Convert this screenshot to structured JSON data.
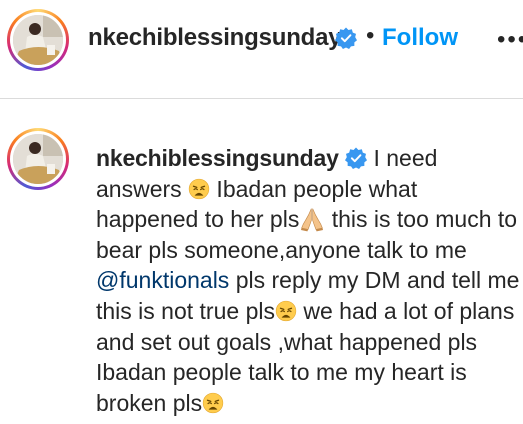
{
  "header": {
    "username": "nkechiblessingsunday",
    "separator": "•",
    "follow_label": "Follow",
    "more_label": "•••"
  },
  "comment": {
    "username": "nkechiblessingsunday",
    "text_1": " I need answers ",
    "text_2": " Ibadan people what happened to her pls",
    "text_3": " this is too much to bear pls someone,anyone talk to me ",
    "mention": "@funktionals",
    "text_4": " pls reply my DM and tell me this is not true pls",
    "text_5": " we had a lot of plans and set out goals ,what happened pls Ibadan people talk to me my heart is broken pls"
  },
  "colors": {
    "follow": "#0095f6",
    "verified": "#3897f0",
    "mention": "#00376b",
    "divider": "#dbdbdb"
  },
  "icons": {
    "verified": "verified-badge-icon",
    "weary_face": "weary-face-emoji",
    "praying_hands": "praying-hands-emoji"
  }
}
